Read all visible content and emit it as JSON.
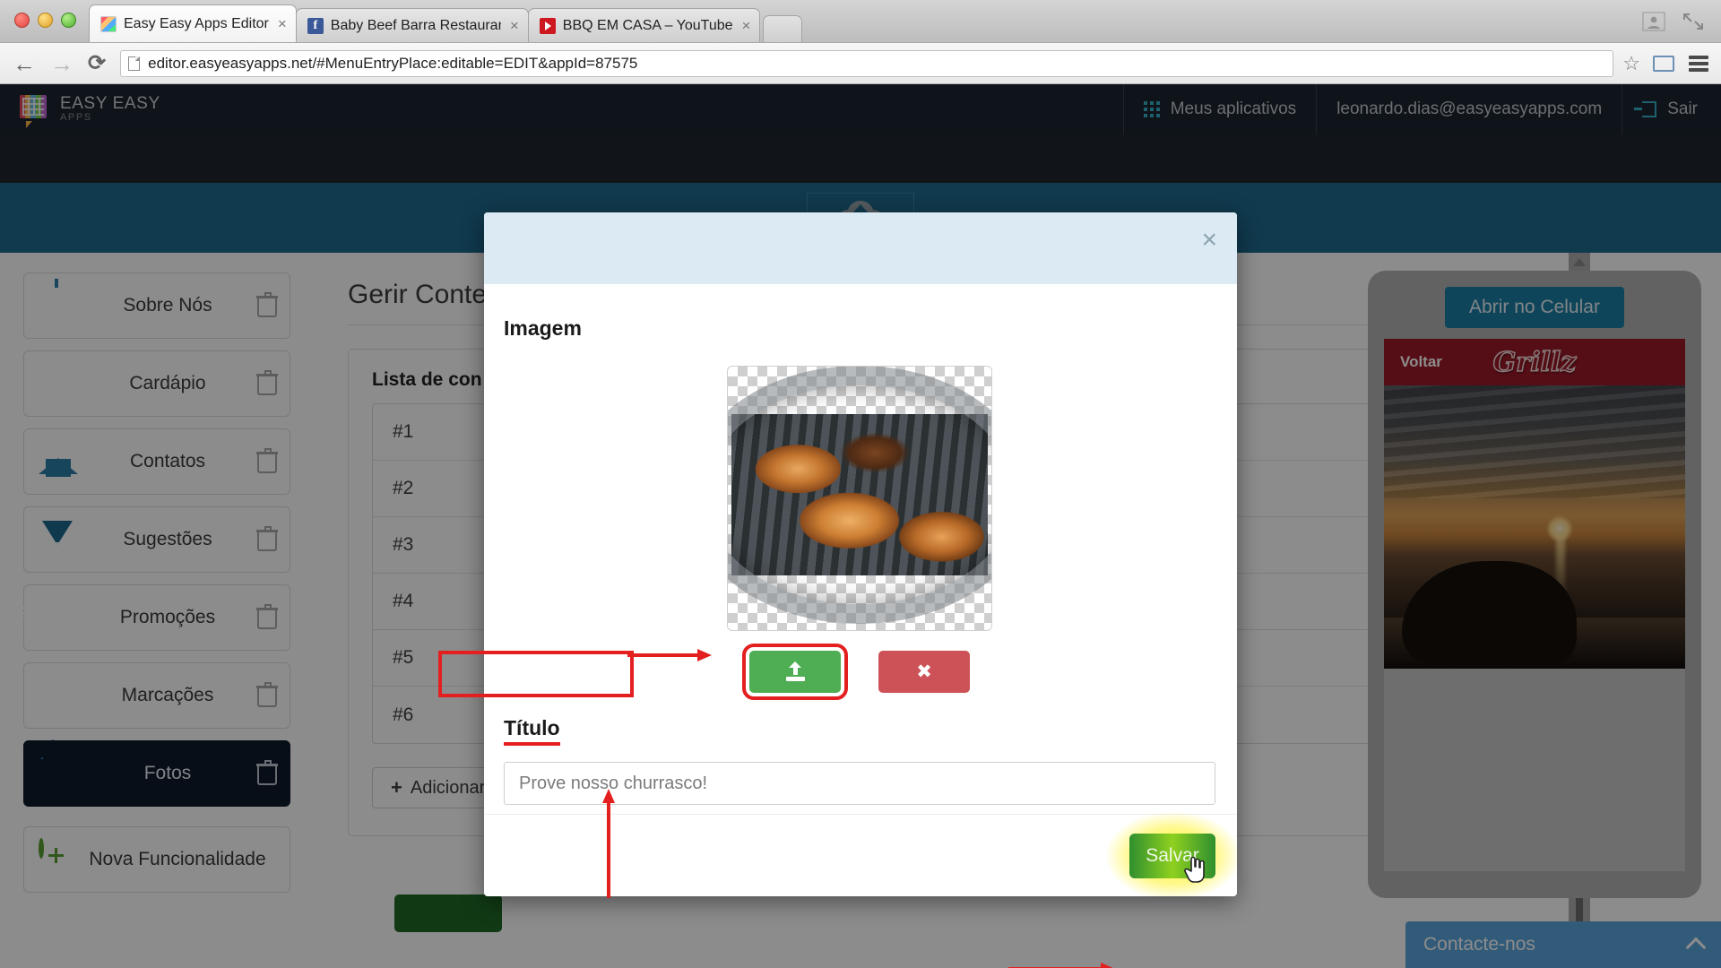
{
  "browser": {
    "tabs": [
      {
        "title": "Easy Easy Apps Editor",
        "favicon": "easy-apps-icon",
        "active": true
      },
      {
        "title": "Baby Beef Barra Restauran",
        "favicon": "facebook-icon",
        "active": false
      },
      {
        "title": "BBQ EM CASA – YouTube",
        "favicon": "youtube-icon",
        "active": false
      }
    ],
    "url": "editor.easyeasyapps.net/#MenuEntryPlace:editable=EDIT&appId=87575",
    "url_domain": "editor.easyeasyapps.net",
    "url_path": "/#MenuEntryPlace:editable=EDIT&appId=87575",
    "back_icon": "back-arrow-icon",
    "forward_icon": "forward-arrow-icon",
    "reload_icon": "reload-icon",
    "bookmark_icon": "star-icon",
    "cast_icon": "cast-icon",
    "menu_icon": "hamburger-menu-icon",
    "tab_close_label": "×"
  },
  "topnav": {
    "logo_line1": "EASY EASY",
    "logo_line2": "APPS",
    "my_apps": "Meus aplicativos",
    "account_email": "leonardo.dias@easyeasyapps.com",
    "logout": "Sair"
  },
  "toolbar": {
    "publish_icon": "cloud-upload-icon"
  },
  "sidebar": {
    "items": [
      {
        "label": "Sobre Nós",
        "icon": "open-sign-icon",
        "active": false
      },
      {
        "label": "Cardápio",
        "icon": "book-icon",
        "active": false
      },
      {
        "label": "Contatos",
        "icon": "home-icon",
        "active": false
      },
      {
        "label": "Sugestões",
        "icon": "envelope-icon",
        "active": false
      },
      {
        "label": "Promoções",
        "icon": "receipt-dollar-icon",
        "active": false
      },
      {
        "label": "Marcações",
        "icon": "calendar-icon",
        "active": false
      },
      {
        "label": "Fotos",
        "icon": "photos-icon",
        "active": true
      }
    ],
    "delete_icon": "trash-icon",
    "new_feature": {
      "label": "Nova Funcionalidade",
      "icon": "plus-circle-icon"
    }
  },
  "content": {
    "page_title": "Gerir Conte",
    "panel_title": "Lista de con",
    "rows": [
      "#1",
      "#2",
      "#3",
      "#4",
      "#5",
      "#6"
    ],
    "add_button": "Adicionar",
    "add_button_icon": "plus-icon"
  },
  "preview": {
    "open_mobile": "Abrir no Celular",
    "app_back": "Voltar",
    "app_brand": "Grillz",
    "contact_bar": "Contacte-nos",
    "contact_chevron": "chevron-up-icon"
  },
  "modal": {
    "close_label": "×",
    "image_label": "Imagem",
    "image_preview_alt": "grilled-food-photo",
    "upload_icon": "upload-icon",
    "remove_icon": "close-x-icon",
    "title_label": "Título",
    "title_value": "Prove nosso churrasco!",
    "save_label": "Salvar",
    "cursor_icon": "hand-pointer-cursor"
  },
  "annotations": {
    "accent_color": "#e41f1f",
    "highlight_glow": "#fff200",
    "arrow_to_upload": "arrow-right",
    "arrow_to_title": "arrow-up",
    "arrow_to_save": "arrow-right"
  },
  "colors": {
    "topnav_bg": "#1d2630",
    "toolbar_bg": "#1e6a8e",
    "sidebar_active_bg": "#0d1b2a",
    "icon_blue": "#2a7fa8",
    "modal_header_bg": "#dbeaf3",
    "btn_green": "#4fad53",
    "btn_red": "#cc5257",
    "app_header_red": "#9d1a28",
    "contact_blue": "#5ba7dd"
  }
}
